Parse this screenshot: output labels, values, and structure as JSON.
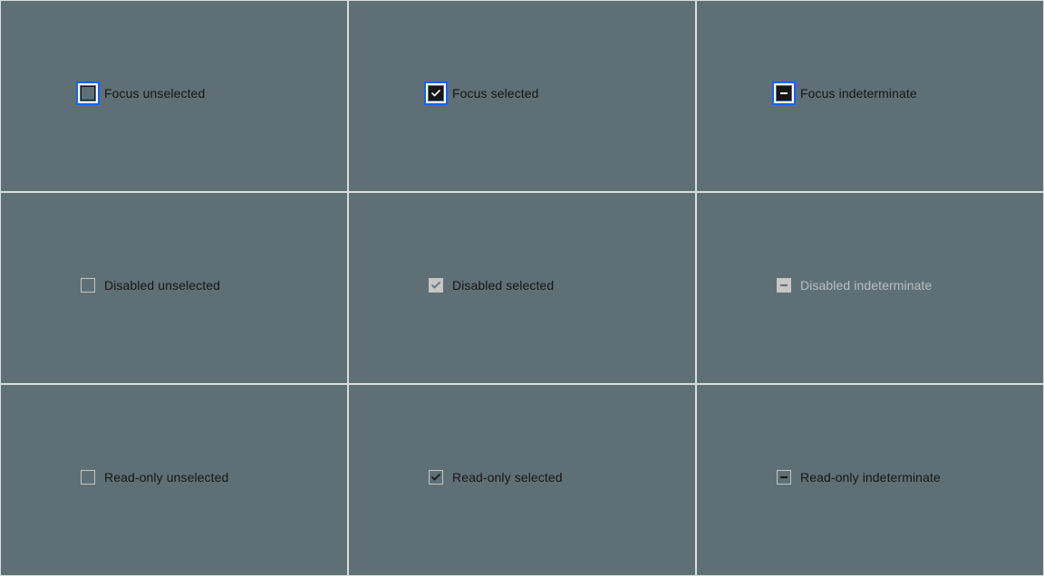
{
  "labels": {
    "focus_unselected": "Focus unselected",
    "focus_selected": "Focus selected",
    "focus_indeterminate": "Focus indeterminate",
    "disabled_unselected": "Disabled unselected",
    "disabled_selected": "Disabled selected",
    "disabled_indeterminate": "Disabled indeterminate",
    "readonly_unselected": "Read-only unselected",
    "readonly_selected": "Read-only selected",
    "readonly_indeterminate": "Read-only indeterminate"
  },
  "colors": {
    "focus_ring": "#0f62fe",
    "bg": "#5e7076",
    "cell_border": "#d9dddf",
    "ink": "#161616",
    "disabled": "#c6c6c6"
  }
}
